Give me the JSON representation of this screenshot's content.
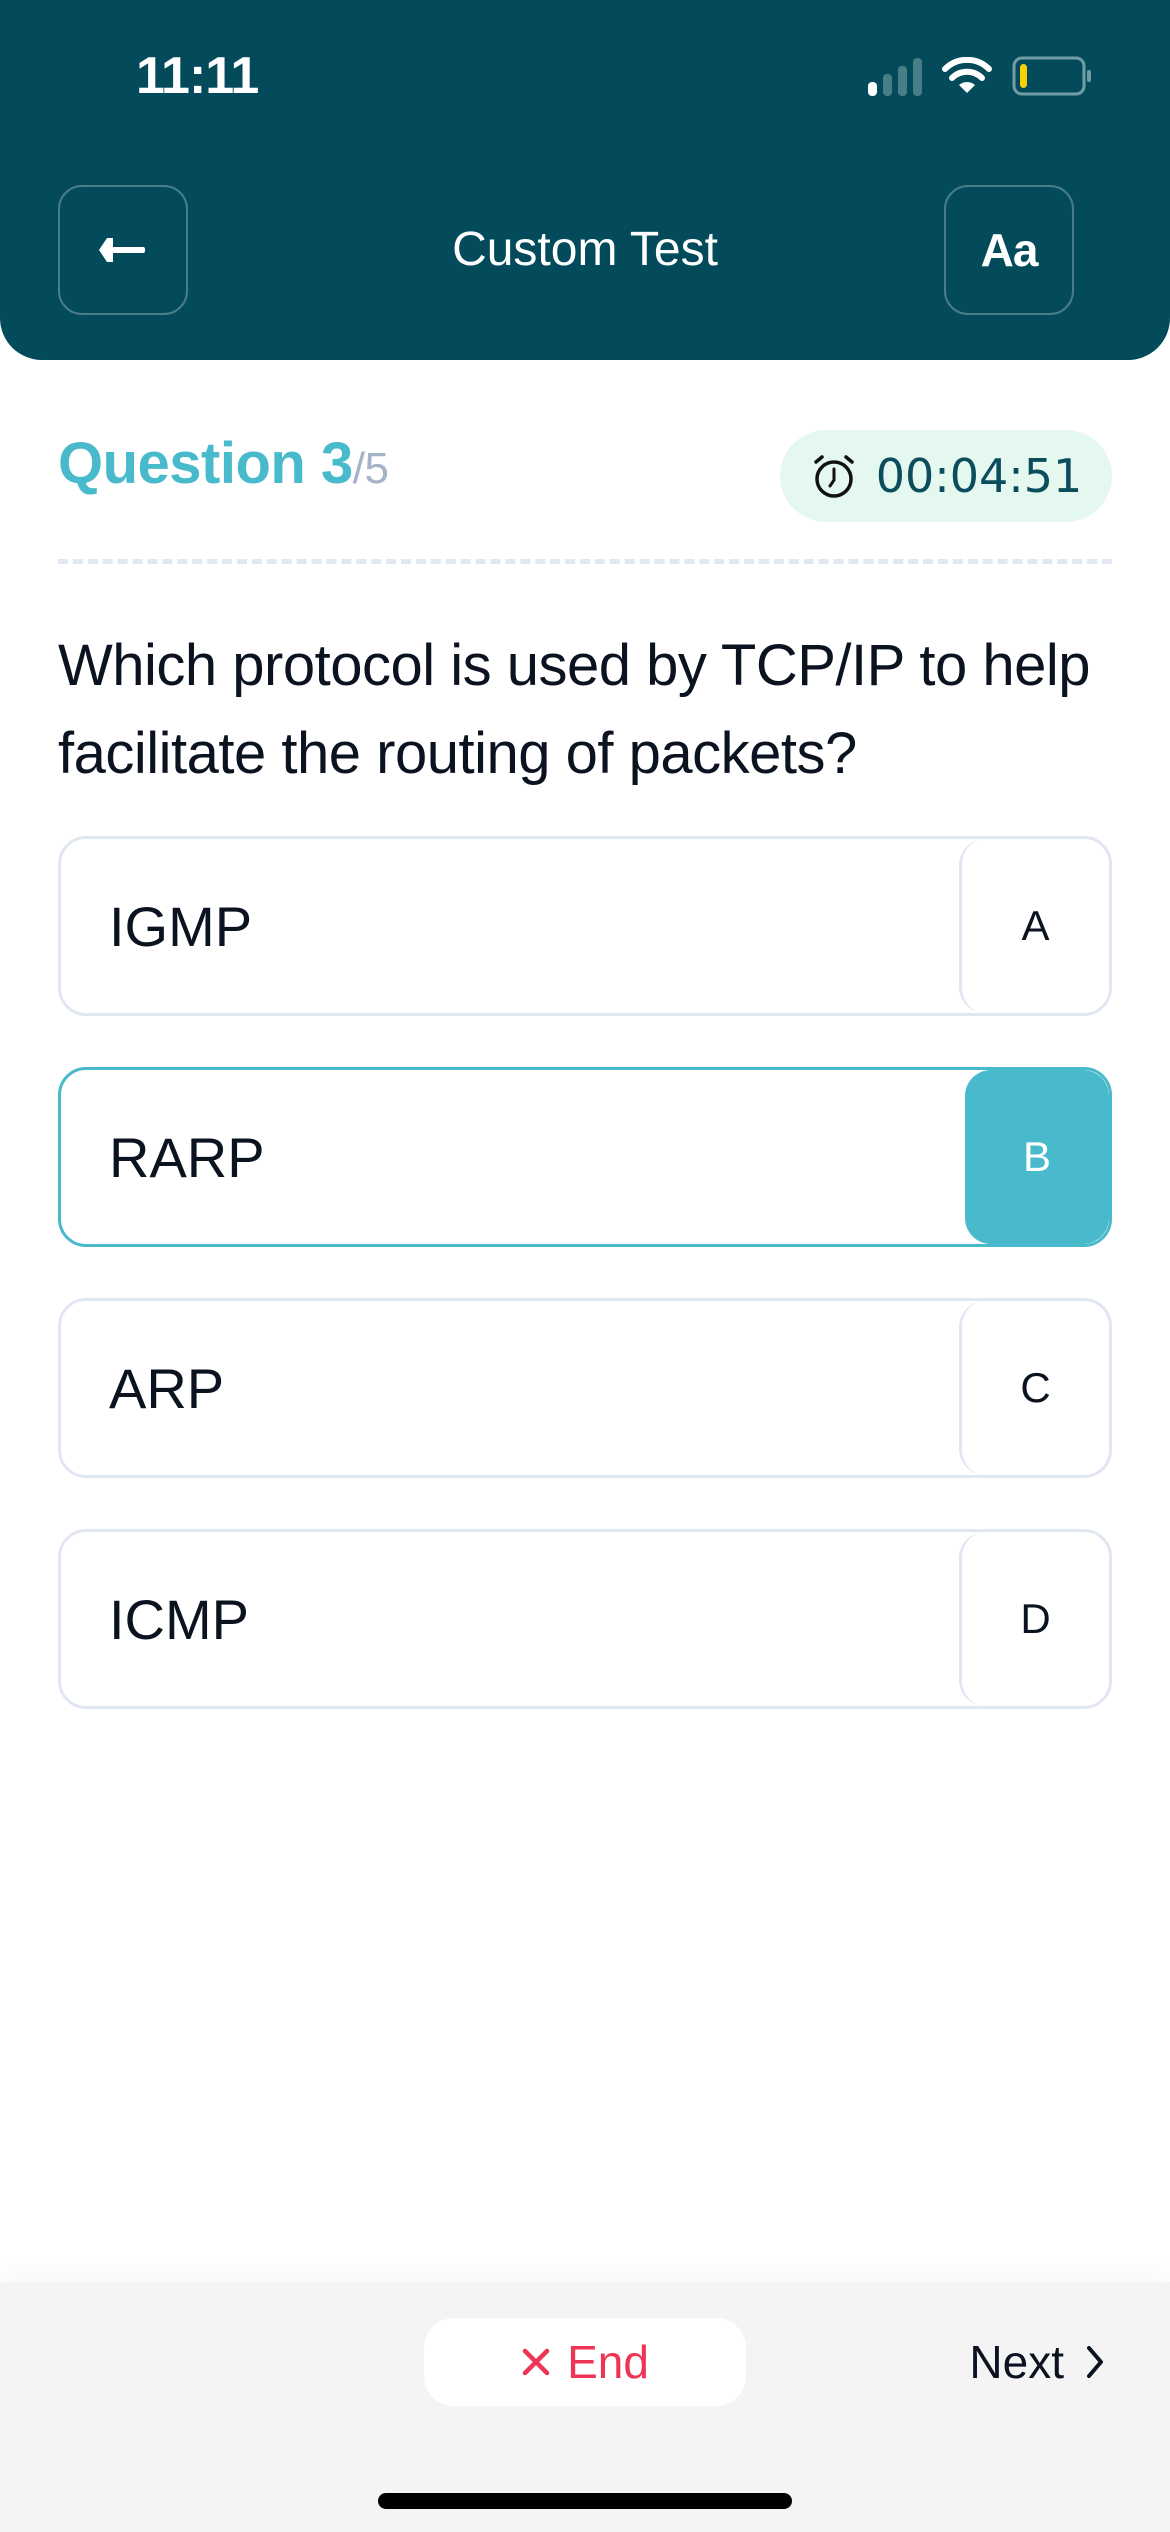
{
  "status_bar": {
    "time": "11:11",
    "signal_bars_active": 1,
    "signal_bars_total": 4,
    "battery_level": 0.1,
    "battery_color": "#f5d20a"
  },
  "header": {
    "title": "Custom Test",
    "back_icon": "arrow-left-icon",
    "font_button_label": "Aa",
    "background": "#034b5a"
  },
  "question_meta": {
    "label": "Question 3",
    "total": "/5",
    "timer": "00:04:51",
    "timer_icon": "alarm-clock-icon",
    "accent": "#48bacc"
  },
  "question": {
    "text": "Which protocol is used by TCP/IP to help facilitate the routing of packets?"
  },
  "options": [
    {
      "letter": "A",
      "text": "IGMP",
      "selected": false
    },
    {
      "letter": "B",
      "text": "RARP",
      "selected": true
    },
    {
      "letter": "C",
      "text": "ARP",
      "selected": false
    },
    {
      "letter": "D",
      "text": "ICMP",
      "selected": false
    }
  ],
  "footer": {
    "end_label": "End",
    "end_icon": "x-icon",
    "end_color": "#ee3556",
    "next_label": "Next",
    "next_icon": "chevron-right-icon"
  }
}
